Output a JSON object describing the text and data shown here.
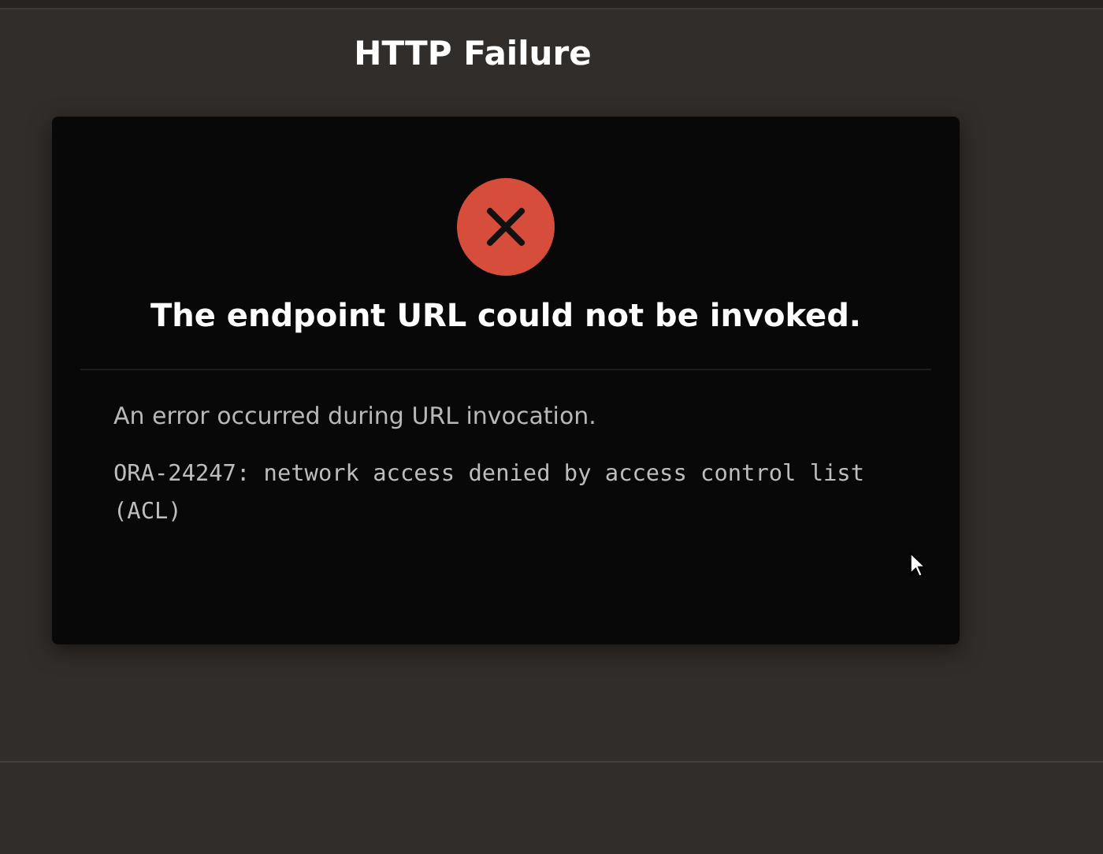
{
  "page": {
    "title": "HTTP Failure"
  },
  "dialog": {
    "kind": "error",
    "heading": "The endpoint URL could not be invoked.",
    "message": "An error occurred during URL invocation.",
    "detail": "ORA-24247: network access denied by access control list (ACL)"
  }
}
